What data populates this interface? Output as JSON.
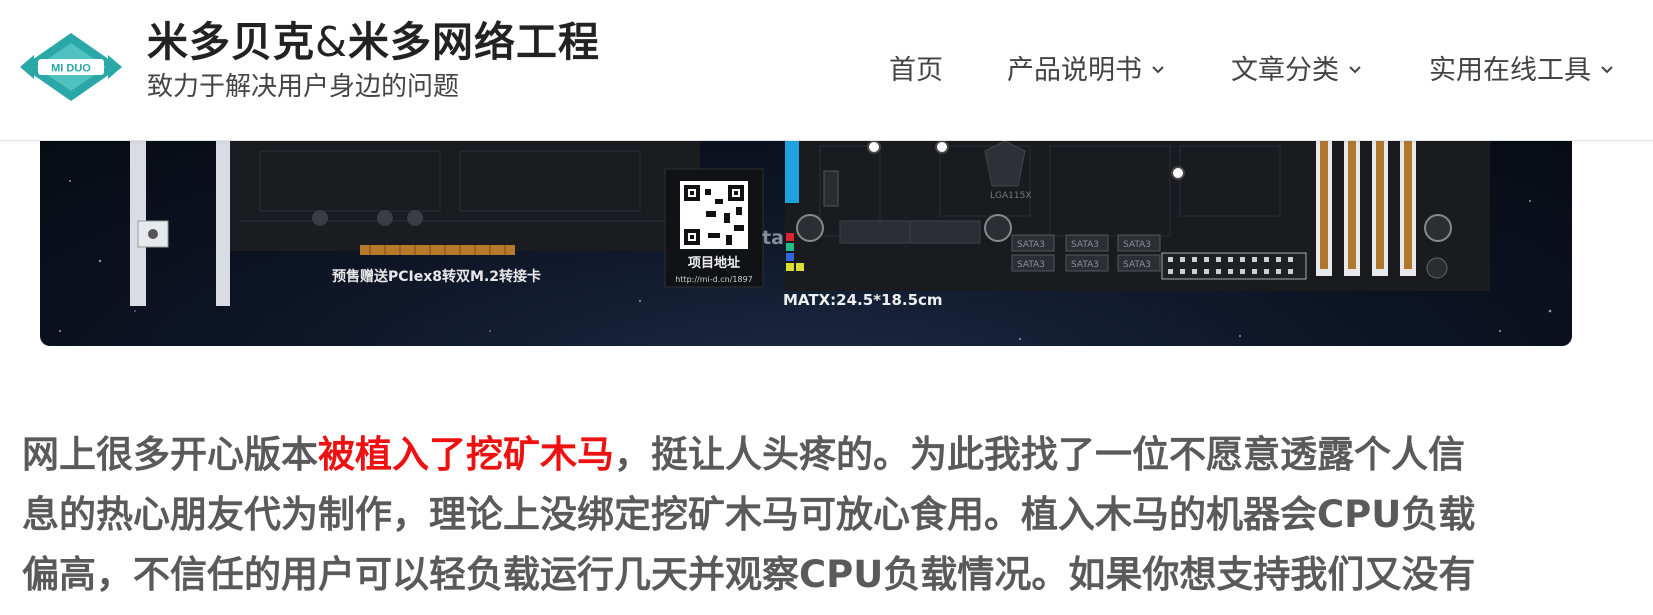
{
  "header": {
    "logo_text": "MI DUO",
    "site_title_a": "米多贝克",
    "site_title_amp": "&",
    "site_title_b": "米多网络工程",
    "tagline": "致力于解决用户身边的问题"
  },
  "nav": {
    "items": [
      {
        "label": "首页",
        "has_dropdown": false
      },
      {
        "label": "产品说明书",
        "has_dropdown": true
      },
      {
        "label": "文章分类",
        "has_dropdown": true
      },
      {
        "label": "实用在线工具",
        "has_dropdown": true
      }
    ]
  },
  "banner": {
    "adapter_caption": "预售赠送PCIex8转双M.2转接卡",
    "qr_caption": "项目地址",
    "qr_url": "http://mi-d.cn/1897",
    "watermark": "tap电玩",
    "size_label": "MATX:24.5*18.5cm",
    "socket_label": "LGA115X",
    "sata_labels": [
      "SATA3",
      "SATA3",
      "SATA3",
      "SATA3",
      "SATA3",
      "SATA3"
    ]
  },
  "article": {
    "line1_a": "网上很多开心版本",
    "line1_highlight": "被植入了挖矿木马",
    "line1_b": "，挺让人头疼的。为此我找了一位不愿意透露个人信",
    "line2": "息的热心朋友代为制作，理论上没绑定挖矿木马可放心食用。植入木马的机器会CPU负载",
    "line3": "偏高，不信任的用户可以轻负载运行几天并观察CPU负载情况。如果你想支持我们又没有"
  },
  "colors": {
    "logo_teal": "#2aa7a7",
    "highlight_red": "#ee1111",
    "article_text": "#5a5a5a",
    "banner_bg": "#0d1424"
  }
}
